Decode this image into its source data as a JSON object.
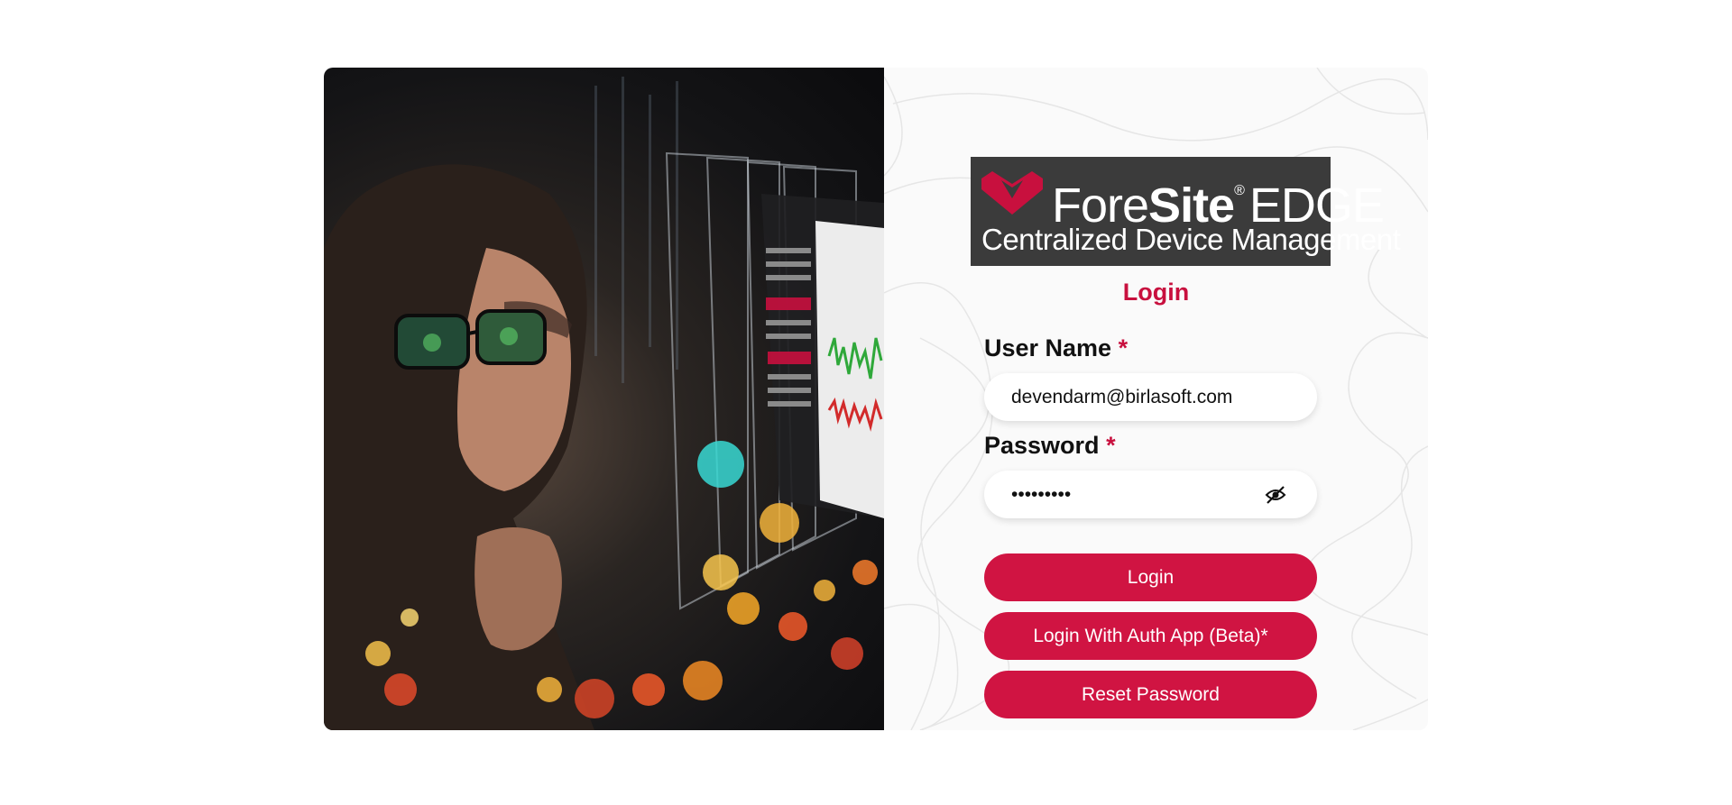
{
  "branding": {
    "brand_part1": "Fore",
    "brand_part2": "Site",
    "brand_reg": "®",
    "brand_part3": "EDGE",
    "subtitle": "Centralized Device Management",
    "accent_color": "#d01442",
    "logo_bg": "#3b3b3b"
  },
  "form": {
    "title": "Login",
    "username": {
      "label": "User Name",
      "required_mark": "*",
      "value": "devendarm@birlasoft.com"
    },
    "password": {
      "label": "Password",
      "required_mark": "*",
      "value": "•••••••••",
      "toggle_icon": "eye-slash-icon"
    },
    "buttons": {
      "login": "Login",
      "auth_app": "Login With Auth App (Beta)*",
      "reset": "Reset Password"
    }
  },
  "hero_image": {
    "subject": "woman-with-glasses-viewing-holographic-dashboard"
  }
}
